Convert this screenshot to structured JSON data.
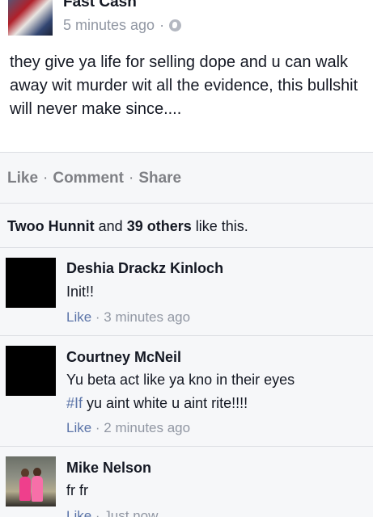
{
  "post": {
    "author": "Fast Cash",
    "timestamp": "5 minutes ago",
    "meta_separator": "·",
    "privacy_icon": "globe-icon",
    "text": "they give ya life for selling dope and u can walk away wit murder wit all the evidence, this bullshit will never make since...."
  },
  "actions": {
    "like": "Like",
    "comment": "Comment",
    "share": "Share",
    "separator": "·"
  },
  "likes": {
    "first_name": "Twoo Hunnit",
    "middle": " and ",
    "others": "39 others",
    "suffix": " like this."
  },
  "comments": [
    {
      "name": "Deshia Drackz Kinloch",
      "text": "Init!!",
      "like": "Like",
      "separator": " · ",
      "time": "3 minutes ago"
    },
    {
      "name": "Courtney McNeil",
      "text_line1": "Yu beta act like ya kno in their eyes",
      "hashtag": "#If",
      "text_line2_rest": " yu aint white u aint rite!!!!",
      "like": "Like",
      "separator": " · ",
      "time": "2 minutes ago"
    },
    {
      "name": "Mike Nelson",
      "text": "fr fr",
      "like": "Like",
      "separator": " · ",
      "time": "Just now"
    }
  ],
  "colors": {
    "link_blue": "#5b74a8",
    "meta_gray": "#9197a3",
    "action_gray": "#7f8085",
    "background_gray": "#f6f7f9"
  }
}
